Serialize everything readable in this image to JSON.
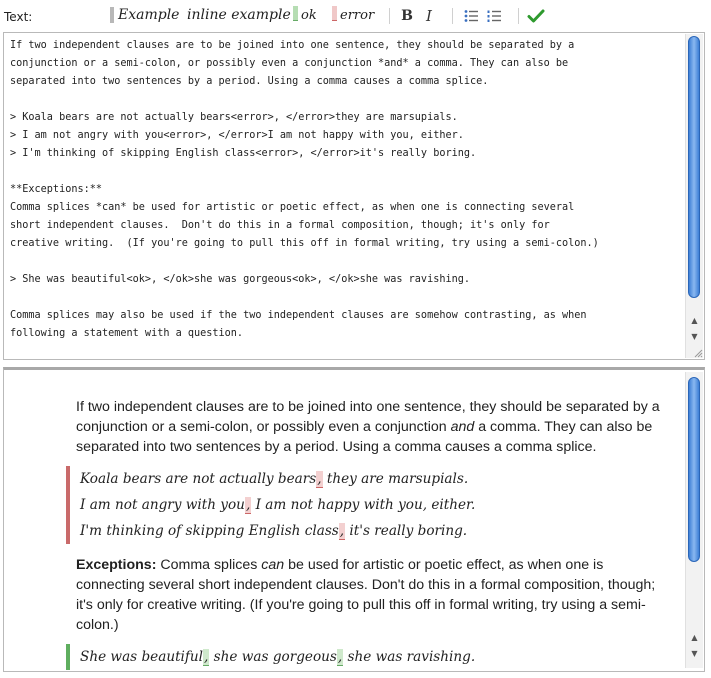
{
  "toolbar": {
    "label": "Text:",
    "example": "Example",
    "inline_example": "inline example",
    "ok": "ok",
    "error": "error",
    "bold": "B",
    "italic": "I",
    "icons": [
      "bulleted-list-icon",
      "numbered-list-icon",
      "checkmark-icon"
    ]
  },
  "editor": {
    "lines": [
      "If two independent clauses are to be joined into one sentence, they should be separated by a",
      "conjunction or a semi-colon, or possibly even a conjunction *and* a comma. They can also be",
      "separated into two sentences by a period. Using a comma causes a comma splice.",
      "",
      "> Koala bears are not actually bears<error>, </error>they are marsupials.",
      "> I am not angry with you<error>, </error>I am not happy with you, either.",
      "> I'm thinking of skipping English class<error>, </error>it's really boring.",
      "",
      "**Exceptions:**",
      "Comma splices *can* be used for artistic or poetic effect, as when one is connecting several",
      "short independent clauses.  Don't do this in a formal composition, though; it's only for",
      "creative writing.  (If you're going to pull this off in formal writing, try using a semi-colon.)",
      "",
      "> She was beautiful<ok>, </ok>she was gorgeous<ok>, </ok>she was ravishing.",
      "",
      "Comma splices may also be used if the two independent clauses are somehow contrasting, as when",
      "following a statement with a question."
    ]
  },
  "preview": {
    "para1_a": "If two independent clauses are to be joined into one sentence, they should be separated by a conjunction or a semi-colon, or possibly even a conjunction ",
    "para1_em": "and",
    "para1_b": " a comma. They can also be separated into two sentences by a period. Using a comma causes a comma splice.",
    "quote1": [
      {
        "pre": "Koala bears are not actually bears",
        "comma": ",",
        "post": " they are marsupials."
      },
      {
        "pre": "I am not angry with you",
        "comma": ",",
        "post": " I am not happy with you, either."
      },
      {
        "pre": "I'm thinking of skipping English class",
        "comma": ",",
        "post": " it's really boring."
      }
    ],
    "exceptions_label": "Exceptions:",
    "exc_a": " Comma splices ",
    "exc_em": "can",
    "exc_b": " be used for artistic or poetic effect, as when one is connecting several short independent clauses. Don't do this in a formal composition, though; it's only for creative writing. (If you're going to pull this off in formal writing, try using a semi-colon.)",
    "quote2": {
      "p1": "She was beautiful",
      "c1": ",",
      "p2": " she was gorgeous",
      "c2": ",",
      "p3": " she was ravishing."
    }
  }
}
